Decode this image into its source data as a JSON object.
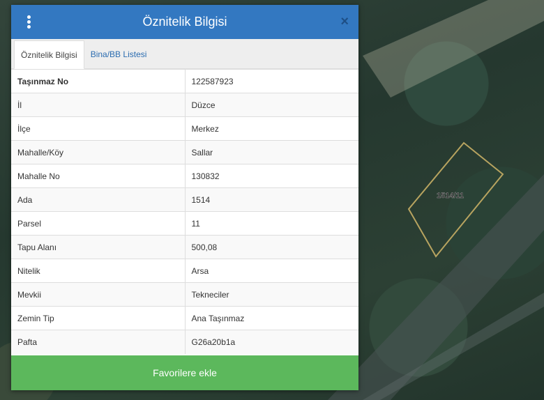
{
  "panel": {
    "title": "Öznitelik Bilgisi",
    "menu_icon": "vertical-ellipsis-icon",
    "close_label": "×"
  },
  "tabs": [
    {
      "label": "Öznitelik Bilgisi",
      "active": true
    },
    {
      "label": "Bina/BB Listesi",
      "active": false
    }
  ],
  "attributes": [
    {
      "key": "Taşınmaz No",
      "value": "122587923"
    },
    {
      "key": "İl",
      "value": "Düzce"
    },
    {
      "key": "İlçe",
      "value": "Merkez"
    },
    {
      "key": "Mahalle/Köy",
      "value": "Sallar"
    },
    {
      "key": "Mahalle No",
      "value": "130832"
    },
    {
      "key": "Ada",
      "value": "1514"
    },
    {
      "key": "Parsel",
      "value": "11"
    },
    {
      "key": "Tapu Alanı",
      "value": "500,08"
    },
    {
      "key": "Nitelik",
      "value": "Arsa"
    },
    {
      "key": "Mevkii",
      "value": "Tekneciler"
    },
    {
      "key": "Zemin Tip",
      "value": "Ana Taşınmaz"
    },
    {
      "key": "Pafta",
      "value": "G26a20b1a"
    }
  ],
  "footer": {
    "favorite_label": "Favorilere ekle"
  },
  "map": {
    "parcel_label": "1514/11",
    "parcel_color": "#b8a460"
  },
  "colors": {
    "header": "#3378c1",
    "button": "#5cb85c"
  }
}
